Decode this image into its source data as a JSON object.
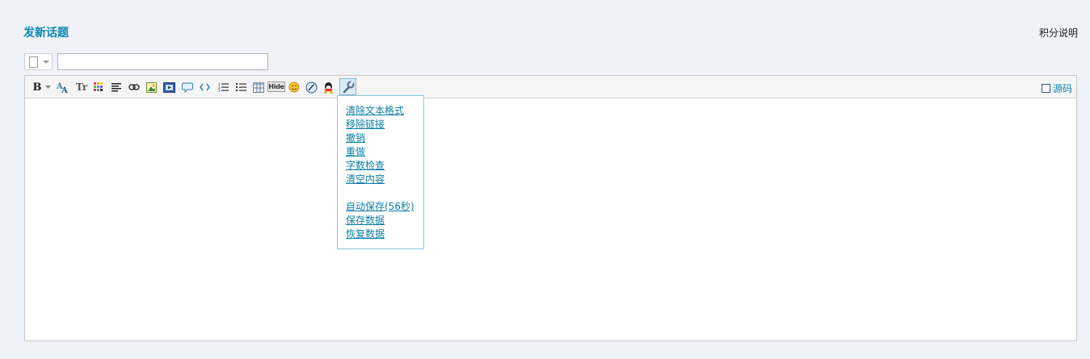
{
  "header": {
    "title": "发新话题",
    "points_link": "积分说明"
  },
  "subject": {
    "value": "",
    "placeholder": ""
  },
  "toolbar": {
    "bold_label": "B",
    "font_size_label": "Tr",
    "hide_label": "Hide",
    "source_label": "源码",
    "source_checked": false
  },
  "tools_menu": {
    "items_group1": [
      "清除文本格式",
      "移除链接",
      "撤销",
      "重做",
      "字数检查",
      "清空内容"
    ],
    "items_group2": [
      "自动保存(56秒)",
      "保存数据",
      "恢复数据"
    ]
  },
  "colors": {
    "accent": "#0b8ab0",
    "link": "#0c7fa7",
    "background": "#eff2f7"
  }
}
